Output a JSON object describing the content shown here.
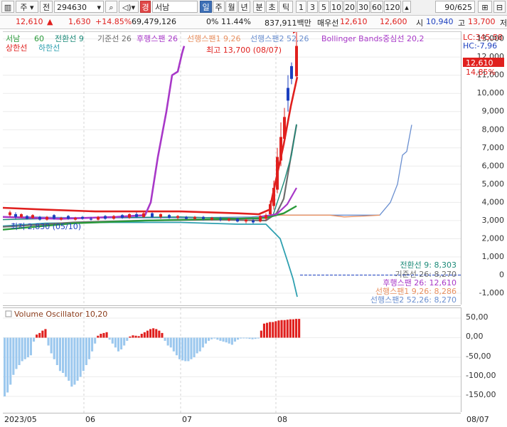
{
  "toolbar": {
    "market": "주",
    "code_prefix": "전",
    "code": "294630",
    "warn_badge": "경",
    "stock_name": "서남",
    "periods": [
      "일",
      "주",
      "월",
      "년",
      "분",
      "초",
      "틱"
    ],
    "active_period": "일",
    "intervals": [
      "1",
      "3",
      "5",
      "10",
      "20",
      "30",
      "60",
      "120"
    ],
    "count": "90/625"
  },
  "quote": {
    "price": "12,610",
    "change": "1,630",
    "change_pct": "+14.85%",
    "volume": "69,479,126",
    "turnover": "0% 11.44%",
    "amount": "837,911백만",
    "bid_label": "매우선",
    "bid": "12,610",
    "ask": "12,600",
    "open_label": "시",
    "open": "10,940",
    "high_label": "고",
    "high": "13,700",
    "low_label": "저"
  },
  "legend": {
    "name": "서남",
    "ma": "60",
    "conversion": "전환선 9",
    "base": "기준선 26",
    "lagging": "후행스팬 26",
    "span1": "선행스팬1 9,26",
    "span2": "선행스팬2 52,26",
    "bollinger": "Bollinger Bands중심선 20,2",
    "upper_band": "상한선",
    "lower_band": "하한선"
  },
  "price_axis": {
    "lc": "LC:345,58",
    "hc": "HC:-7,96",
    "ticks": [
      "13,000",
      "12,000",
      "11,000",
      "10,000",
      "9,000",
      "8,000",
      "7,000",
      "6,000",
      "5,000",
      "4,000",
      "3,000",
      "2,000",
      "1,000",
      "0",
      "-1,000"
    ],
    "current_price": "12,610",
    "current_pct": "14,85%"
  },
  "annotations": {
    "high": "최고 13,700 (08/07)",
    "low": "최저 2,830 (05/10)"
  },
  "right_labels": [
    "전환선 9: 8,303",
    "기준선 26: 8,270",
    "후행스팬 26: 12,610",
    "선행스팬1 9,26: 8,286",
    "선행스팬2 52,26: 8,270"
  ],
  "oscillator": {
    "title": "Volume Oscillator 10,20",
    "ticks": [
      "50,00",
      "0,00",
      "-50,00",
      "-100,00",
      "-150,00"
    ]
  },
  "xaxis": {
    "labels": [
      "2023/05",
      "06",
      "07",
      "08"
    ],
    "right_label": "08/07"
  },
  "colors": {
    "up": "#e0201e",
    "down": "#1c3fbf",
    "conversion": "#1b8a78",
    "base": "#6d6d6d",
    "lagging": "#a838c8",
    "span1": "#e89060",
    "span2": "#6a8fd0",
    "bollinger": "#a838c8",
    "upper": "#e0201e",
    "lower": "#2ea0b0",
    "ma": "#2a9a3a",
    "osc_pos": "#e0201e",
    "osc_neg": "#9cc8ee"
  },
  "chart_data": {
    "type": "line",
    "title": "서남",
    "x": [
      "2023/05",
      "06",
      "07",
      "08",
      "08/07"
    ],
    "ylim": [
      -1000,
      13700
    ],
    "series": [
      {
        "name": "후행스팬 26",
        "values": [
          3100,
          3050,
          3200,
          12610
        ]
      },
      {
        "name": "전환선 9",
        "values": [
          3000,
          3100,
          3200,
          8303
        ]
      },
      {
        "name": "기준선 26",
        "values": [
          3000,
          3050,
          3150,
          8270
        ]
      },
      {
        "name": "선행스팬1 9,26",
        "values": [
          3300,
          3250,
          3300,
          8286
        ]
      },
      {
        "name": "선행스팬2 52,26",
        "values": [
          3300,
          3300,
          3300,
          8270
        ]
      },
      {
        "name": "상한선",
        "values": [
          3700,
          3500,
          3300,
          10900
        ]
      },
      {
        "name": "하한선",
        "values": [
          2700,
          2900,
          2900,
          -1200
        ]
      }
    ],
    "high": 13700,
    "low": 2830,
    "last": 12610,
    "oscillator": {
      "name": "Volume Oscillator 10,20",
      "ylim": [
        -180,
        60
      ]
    }
  }
}
